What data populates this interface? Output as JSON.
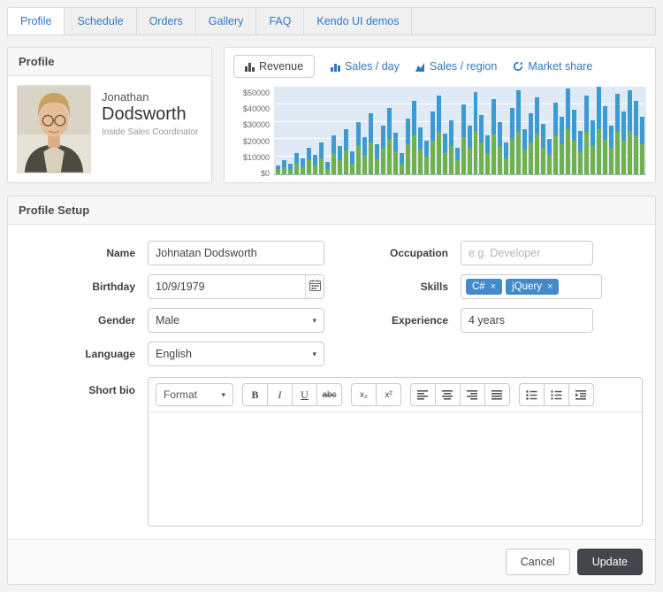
{
  "nav": {
    "tabs": [
      {
        "label": "Profile"
      },
      {
        "label": "Schedule"
      },
      {
        "label": "Orders"
      },
      {
        "label": "Gallery"
      },
      {
        "label": "FAQ"
      },
      {
        "label": "Kendo UI demos"
      }
    ]
  },
  "profile_card": {
    "title": "Profile",
    "first_name": "Jonathan",
    "last_name": "Dodsworth",
    "role": "Inside Sales Coordinator"
  },
  "chart_panel": {
    "tabs": [
      {
        "label": "Revenue"
      },
      {
        "label": "Sales / day"
      },
      {
        "label": "Sales / region"
      },
      {
        "label": "Market share"
      }
    ]
  },
  "chart_data": {
    "type": "bar",
    "stacked": true,
    "title": "Revenue",
    "xlabel": "",
    "ylabel": "",
    "ylim": [
      0,
      50000
    ],
    "yticks": [
      "$0",
      "$10000",
      "$20000",
      "$30000",
      "$40000",
      "$50000"
    ],
    "grid": true,
    "legend": "none",
    "plot_background": "#dfeaf4",
    "series": [
      {
        "name": "green-series",
        "color": "#71b14d",
        "values": [
          3000,
          4000,
          3000,
          6000,
          4000,
          8000,
          5000,
          9000,
          3000,
          12000,
          8000,
          14000,
          6000,
          16000,
          11000,
          18000,
          9000,
          15000,
          20000,
          13000,
          6000,
          17000,
          22000,
          14000,
          10000,
          19000,
          24000,
          12000,
          16000,
          8000,
          21000,
          15000,
          25000,
          18000,
          12000,
          23000,
          16000,
          9000,
          20000,
          25000,
          14000,
          18000,
          23000,
          15000,
          11000,
          22000,
          17000,
          26000,
          19000,
          13000,
          24000,
          16000,
          26000,
          20000,
          15000,
          24000,
          19000,
          25000,
          22000,
          17000
        ]
      },
      {
        "name": "blue-series",
        "color": "#3d9bd4",
        "values": [
          2000,
          4000,
          3000,
          6000,
          5000,
          7000,
          6000,
          9000,
          4000,
          10000,
          8000,
          12000,
          7000,
          14000,
          10000,
          17000,
          8000,
          13000,
          18000,
          11000,
          6000,
          15000,
          20000,
          13000,
          9000,
          17000,
          21000,
          11000,
          15000,
          7000,
          19000,
          13000,
          22000,
          16000,
          10000,
          20000,
          14000,
          9000,
          18000,
          23000,
          12000,
          17000,
          21000,
          14000,
          9000,
          19000,
          16000,
          23000,
          18000,
          12000,
          21000,
          15000,
          24000,
          19000,
          13000,
          22000,
          17000,
          23000,
          20000,
          16000
        ]
      }
    ]
  },
  "form": {
    "title": "Profile Setup",
    "fields": {
      "name": {
        "label": "Name",
        "value": "Johnatan Dodsworth"
      },
      "occupation": {
        "label": "Occupation",
        "placeholder": "e.g. Developer"
      },
      "birthday": {
        "label": "Birthday",
        "value": "10/9/1979"
      },
      "skills": {
        "label": "Skills",
        "tags": [
          "C#",
          "jQuery"
        ]
      },
      "gender": {
        "label": "Gender",
        "value": "Male"
      },
      "experience": {
        "label": "Experience",
        "value": "4 years"
      },
      "language": {
        "label": "Language",
        "value": "English"
      },
      "bio": {
        "label": "Short bio"
      }
    },
    "editor": {
      "format_label": "Format",
      "glyphs": {
        "bold": "B",
        "italic": "I",
        "underline": "U",
        "strikethrough": "abc",
        "subscript": "x₂",
        "superscript": "x²"
      }
    },
    "actions": {
      "cancel": "Cancel",
      "update": "Update"
    }
  },
  "icons": {
    "caret": "▾",
    "remove": "×",
    "spin_up": "▴",
    "spin_down": "▾"
  },
  "colors": {
    "link_blue": "#3079c2",
    "tag_blue": "#428bca",
    "bar_green": "#71b14d",
    "bar_blue": "#3d9bd4",
    "update_button": "#43464b"
  }
}
